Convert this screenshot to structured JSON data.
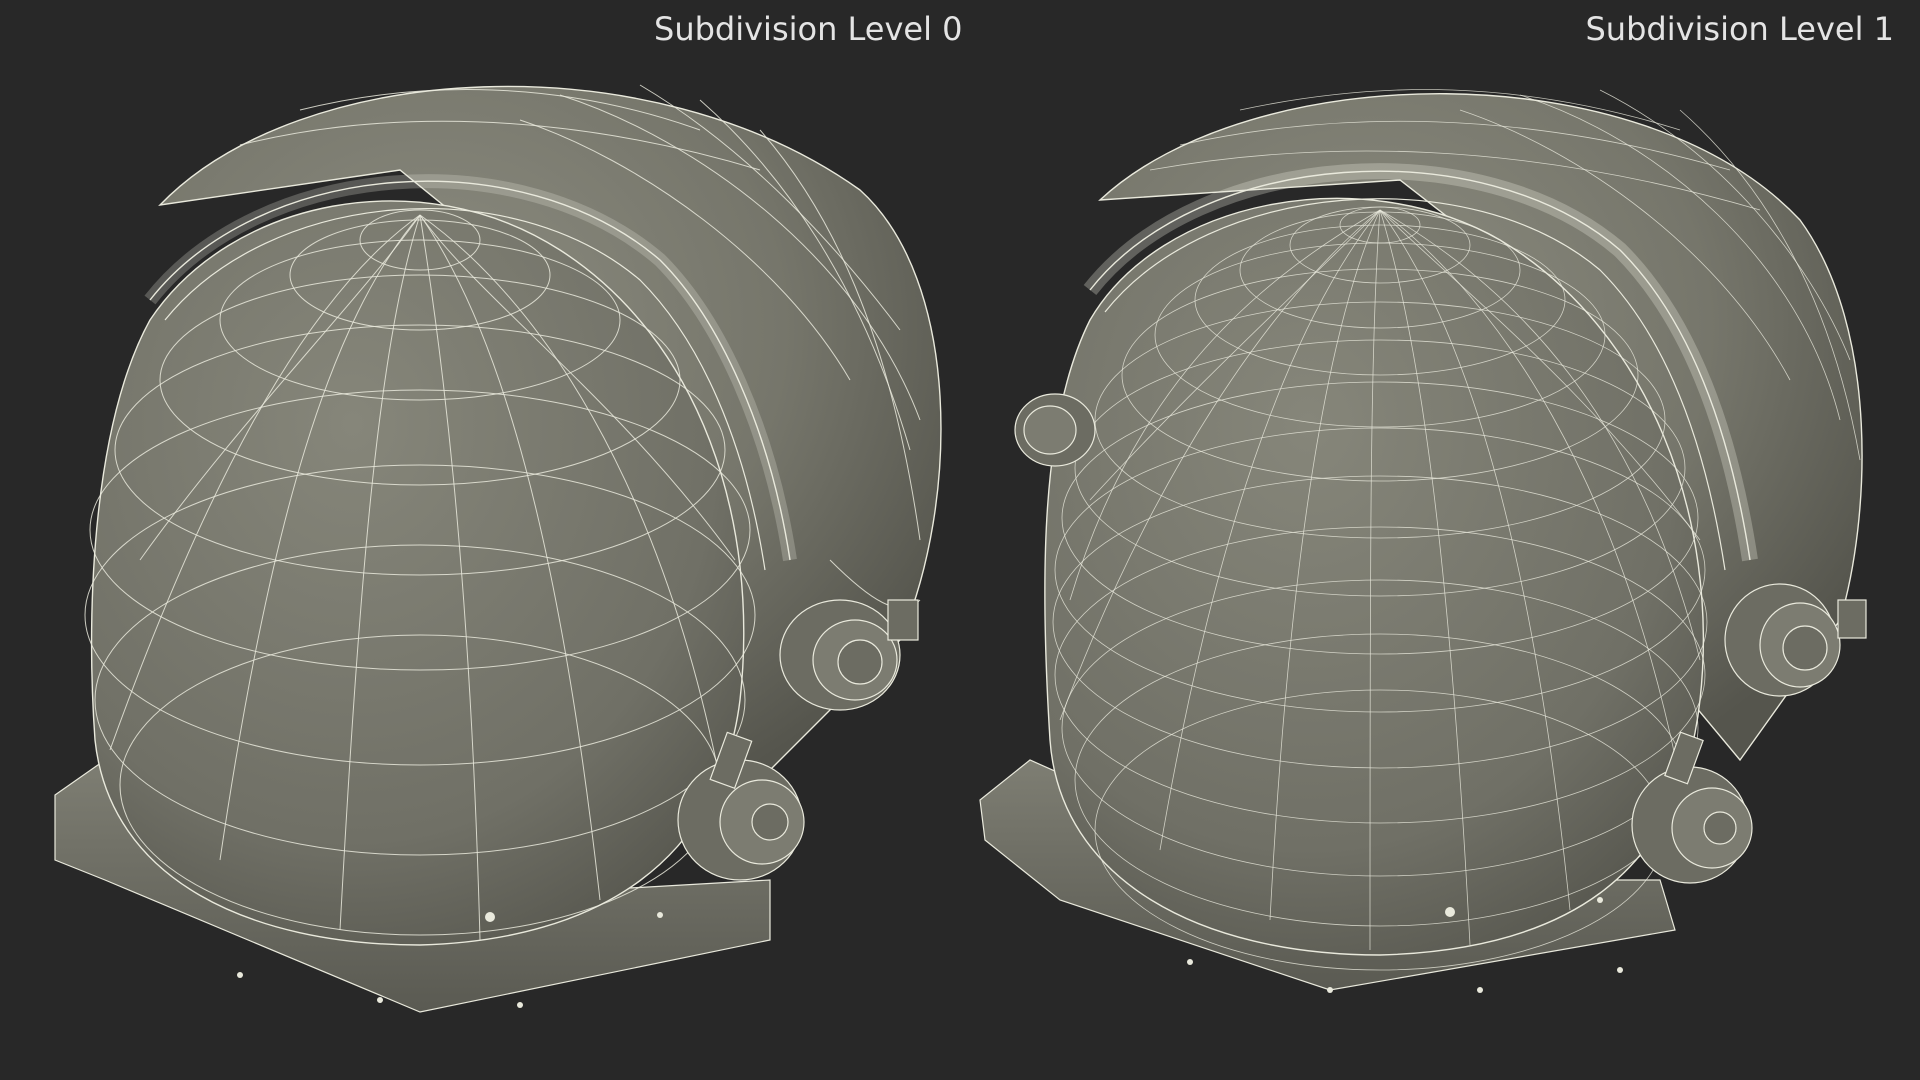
{
  "canvas": {
    "background": "#282828"
  },
  "labels": {
    "left": "Subdivision Level 0",
    "right": "Subdivision Level 1"
  },
  "helmets": [
    {
      "subdivision_level": 0,
      "wire_density": 1
    },
    {
      "subdivision_level": 1,
      "wire_density": 2
    }
  ],
  "colors": {
    "shell": "#77776c",
    "shell_dark": "#5c5c53",
    "shell_light": "#8d8d80",
    "wire": "#e9e9dc",
    "label_text": "#e4e4e4"
  }
}
